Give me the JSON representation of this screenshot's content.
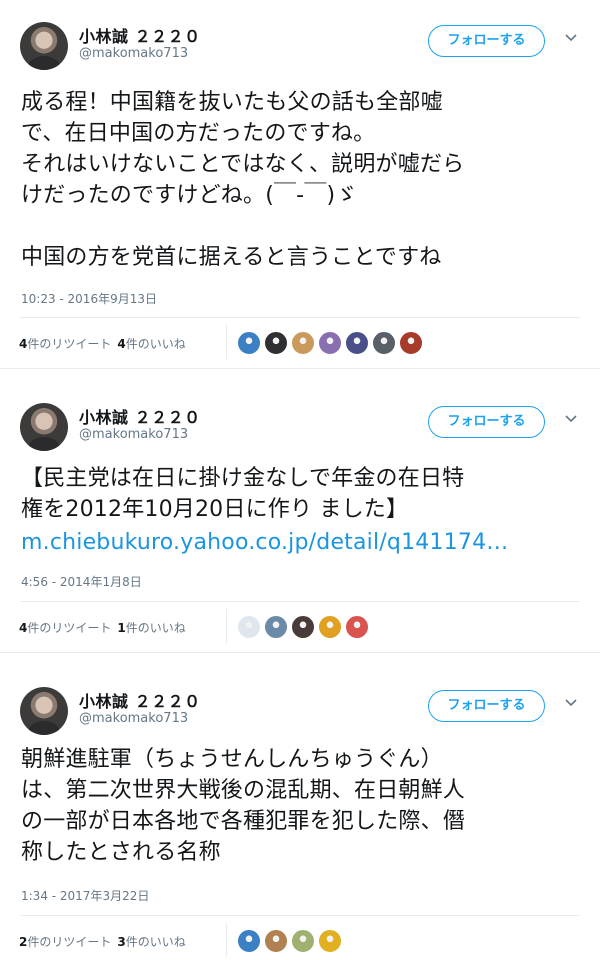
{
  "tweets": [
    {
      "name": "小林誠 ２２２０",
      "handle": "@makomako713",
      "follow_label": "フォローする",
      "text": "成る程！中国籍を抜いたも父の話も全部嘘\nで、在日中国の方だったのですね。\nそれはいけないことではなく、説明が嘘だら\nけだったのですけどね。(￣-￣)ゞ\n\n中国の方を党首に据えると言うことですね",
      "timestamp": "10:23 - 2016年9月13日",
      "retweets": {
        "count": "4",
        "label": "件のリツイート"
      },
      "likes": {
        "count": "4",
        "label": "件のいいね"
      },
      "liker_colors": [
        "#3b7fc4",
        "#2f2f34",
        "#c99a5b",
        "#8a6fb0",
        "#4a4f8a",
        "#5a6068",
        "#a83a2a"
      ]
    },
    {
      "name": "小林誠 ２２２０",
      "handle": "@makomako713",
      "follow_label": "フォローする",
      "text": "【民主党は在日に掛け金なしで年金の在日特\n権を2012年10月20日に作り ました】",
      "link": "m.chiebukuro.yahoo.co.jp/detail/q141174…",
      "timestamp": "4:56 - 2014年1月8日",
      "retweets": {
        "count": "4",
        "label": "件のリツイート"
      },
      "likes": {
        "count": "1",
        "label": "件のいいね"
      },
      "liker_colors": [
        "#dfe6ee",
        "#6b8aa8",
        "#4a3b3b",
        "#e0a020",
        "#d9534f"
      ]
    },
    {
      "name": "小林誠 ２２２０",
      "handle": "@makomako713",
      "follow_label": "フォローする",
      "text": "朝鮮進駐軍（ちょうせんしんちゅうぐん）\nは、第二次世界大戦後の混乱期、在日朝鮮人\nの一部が日本各地で各種犯罪を犯した際、僭\n称したとされる名称",
      "timestamp": "1:34 - 2017年3月22日",
      "retweets": {
        "count": "2",
        "label": "件のリツイート"
      },
      "likes": {
        "count": "3",
        "label": "件のいいね"
      },
      "liker_colors": [
        "#3b7fc4",
        "#b08050",
        "#9fb070",
        "#e0b020"
      ]
    }
  ]
}
